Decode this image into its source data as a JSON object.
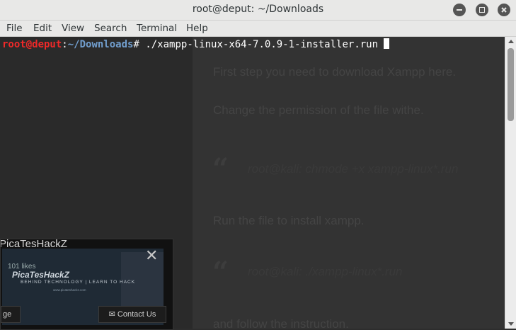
{
  "window": {
    "title": "root@deput: ~/Downloads"
  },
  "menu": [
    "File",
    "Edit",
    "View",
    "Search",
    "Terminal",
    "Help"
  ],
  "terminal": {
    "prompt_user_host": "root@deput",
    "prompt_colon": ":",
    "prompt_path": "~/Downloads",
    "prompt_symbol": "# ",
    "command": "./xampp-linux-x64-7.0.9-1-installer.run "
  },
  "background_page": {
    "line1": "First step you need to download Xampp here.",
    "line2": "Change the permission of the file withe.",
    "quote_mark": "“",
    "quote1": "root@kali: chmode +x xampp-linux*.run",
    "line3": "Run the file to install xampp.",
    "quote2": "root@kali: ./xampp-linux*.run",
    "line4": "and follow the instruction."
  },
  "popup": {
    "title": "PicaTesHackZ",
    "subtitle": "101 likes",
    "brand": "PicaTesHackZ",
    "tagline": "BEHIND TECHNOLOGY | LEARN TO HACK",
    "url": "www.picateshackz.com",
    "close": "✕",
    "left_button": "ge",
    "contact_button": "✉ Contact Us"
  },
  "colors": {
    "prompt_user": "#ef2929",
    "prompt_path": "#729fcf",
    "terminal_bg": "#2a2a2a"
  }
}
